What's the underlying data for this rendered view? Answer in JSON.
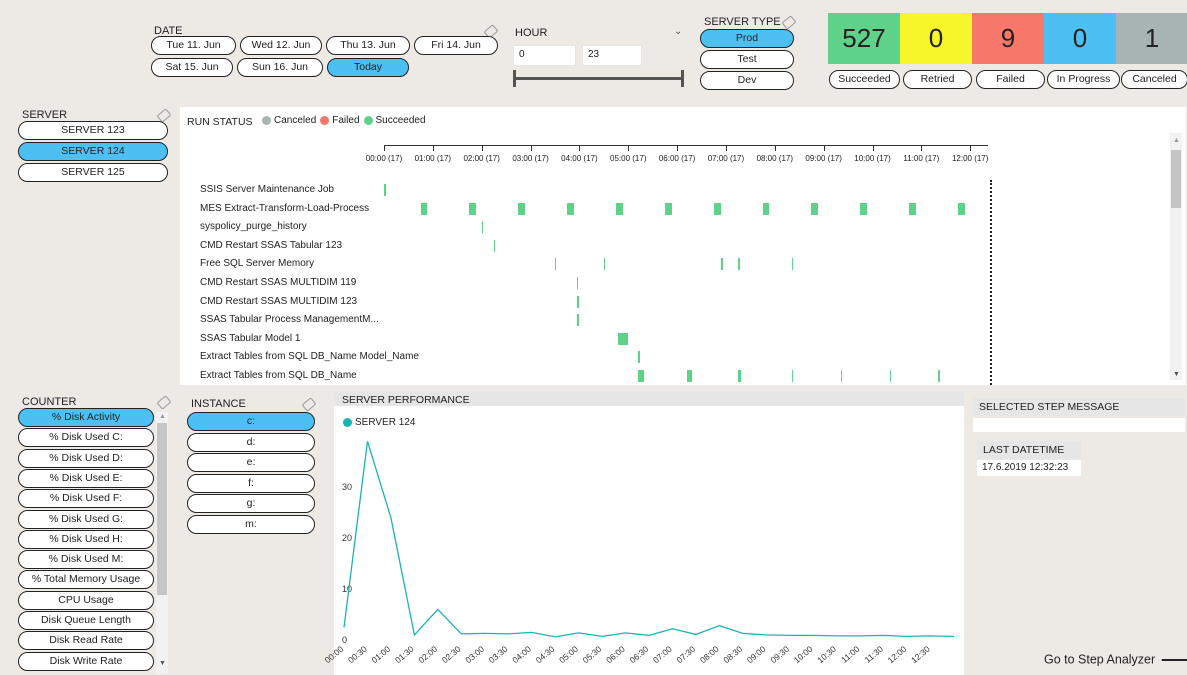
{
  "date": {
    "label": "DATE",
    "buttons": [
      "Tue 11. Jun",
      "Wed 12. Jun",
      "Thu 13. Jun",
      "Fri 14. Jun",
      "Sat 15. Jun",
      "Sun 16. Jun",
      "Today"
    ]
  },
  "hour": {
    "label": "HOUR",
    "min_value": "0",
    "max_value": "23"
  },
  "server_type": {
    "label": "SERVER TYPE",
    "options": [
      "Prod",
      "Test",
      "Dev"
    ],
    "selected": "Prod"
  },
  "kpis": [
    {
      "value": "527",
      "label": "Succeeded",
      "color": "#5fd28a"
    },
    {
      "value": "0",
      "label": "Retried",
      "color": "#f6f62a"
    },
    {
      "value": "9",
      "label": "Failed",
      "color": "#f7786a"
    },
    {
      "value": "0",
      "label": "In Progress",
      "color": "#4cc0f2"
    },
    {
      "value": "1",
      "label": "Canceled",
      "color": "#a8b4b4"
    }
  ],
  "server": {
    "label": "SERVER",
    "items": [
      "SERVER 123",
      "SERVER 124",
      "SERVER 125"
    ],
    "selected": "SERVER 124"
  },
  "run_status": {
    "title": "RUN STATUS",
    "legend": [
      {
        "name": "Canceled",
        "color": "#a8b4b4"
      },
      {
        "name": "Failed",
        "color": "#f7786a"
      },
      {
        "name": "Succeeded",
        "color": "#5fd28a"
      }
    ],
    "time_ticks": [
      "00:00 (17)",
      "01:00 (17)",
      "02:00 (17)",
      "03:00 (17)",
      "04:00 (17)",
      "05:00 (17)",
      "06:00 (17)",
      "07:00 (17)",
      "08:00 (17)",
      "09:00 (17)",
      "10:00 (17)",
      "11:00 (17)",
      "12:00 (17)"
    ],
    "jobs": [
      {
        "name": "SSIS Server Maintenance Job",
        "runs": [
          [
            0.0,
            0.01
          ]
        ]
      },
      {
        "name": "MES Extract-Transform-Load-Process",
        "runs": [
          [
            0.75,
            0.14
          ],
          [
            1.75,
            0.14
          ],
          [
            2.75,
            0.14
          ],
          [
            3.75,
            0.14
          ],
          [
            4.75,
            0.14
          ],
          [
            5.75,
            0.14
          ],
          [
            6.75,
            0.14
          ],
          [
            7.75,
            0.14
          ],
          [
            8.75,
            0.14
          ],
          [
            9.75,
            0.14
          ],
          [
            10.75,
            0.14
          ],
          [
            11.75,
            0.14
          ]
        ]
      },
      {
        "name": "syspolicy_purge_history",
        "runs": [
          [
            2.0,
            0.02
          ]
        ]
      },
      {
        "name": "CMD Restart SSAS Tabular 123",
        "runs": [
          [
            2.25,
            0.02
          ]
        ]
      },
      {
        "name": "Free SQL Server Memory",
        "runs": [
          [
            3.5,
            0.03
          ],
          [
            4.5,
            0.03
          ],
          [
            6.9,
            0.03
          ],
          [
            7.25,
            0.03
          ],
          [
            8.35,
            0.01
          ]
        ]
      },
      {
        "name": "CMD Restart SSAS MULTIDIM 119",
        "runs": [
          [
            3.95,
            0.02
          ]
        ]
      },
      {
        "name": "CMD Restart SSAS MULTIDIM 123",
        "runs": [
          [
            3.95,
            0.04
          ]
        ]
      },
      {
        "name": "SSAS Tabular Process ManagementM...",
        "runs": [
          [
            3.95,
            0.04
          ]
        ]
      },
      {
        "name": "SSAS Tabular Model 1",
        "runs": [
          [
            4.8,
            0.2
          ]
        ]
      },
      {
        "name": "Extract Tables from SQL DB_Name Model_Name",
        "runs": [
          [
            5.2,
            0.02
          ]
        ]
      },
      {
        "name": "Extract Tables from SQL DB_Name",
        "runs": [
          [
            5.2,
            0.12
          ],
          [
            6.2,
            0.1
          ],
          [
            7.25,
            0.06
          ],
          [
            8.35,
            0.02
          ],
          [
            9.35,
            0.02
          ],
          [
            10.35,
            0.02
          ],
          [
            11.35,
            0.02
          ]
        ]
      }
    ],
    "now_marker_hour": 12.4
  },
  "counter": {
    "label": "COUNTER",
    "items": [
      "% Disk Activity",
      "% Disk Used C:",
      "% Disk Used D:",
      "% Disk Used E:",
      "% Disk Used F:",
      "% Disk Used G:",
      "% Disk Used H:",
      "% Disk Used M:",
      "% Total Memory Usage",
      "CPU Usage",
      "Disk Queue Length",
      "Disk Read Rate",
      "Disk Write Rate"
    ],
    "selected": "% Disk Activity"
  },
  "instance": {
    "label": "INSTANCE",
    "items": [
      "c:",
      "d:",
      "e:",
      "f:",
      "g:",
      "m:"
    ],
    "selected": "c:"
  },
  "chart_data": {
    "type": "line",
    "title": "SERVER PERFORMANCE",
    "series": [
      {
        "name": "SERVER 124",
        "color": "#19b5b0",
        "values": [
          2.5,
          39,
          24,
          1,
          6,
          1.2,
          1.3,
          1.2,
          1.5,
          0.6,
          1.4,
          0.7,
          1.4,
          0.9,
          2.2,
          1.1,
          2.8,
          1.3,
          1.0,
          0.9,
          0.9,
          0.8,
          0.8,
          0.9,
          0.7,
          0.8,
          0.7
        ]
      }
    ],
    "x": [
      "00:00",
      "00:30",
      "01:00",
      "01:30",
      "02:00",
      "02:30",
      "03:00",
      "03:30",
      "04:00",
      "04:30",
      "05:00",
      "05:30",
      "06:00",
      "06:30",
      "07:00",
      "07:30",
      "08:00",
      "08:30",
      "09:00",
      "09:30",
      "10:00",
      "10:30",
      "11:00",
      "11:30",
      "12:00",
      "12:30",
      ""
    ],
    "yticks": [
      "0",
      "10",
      "20",
      "30"
    ],
    "ylim": [
      0,
      42
    ]
  },
  "step_message": {
    "label": "SELECTED STEP MESSAGE",
    "last_datetime_label": "LAST DATETIME",
    "last_datetime": "17.6.2019 12:32:23"
  },
  "nav": {
    "go_label": "Go to Step Analyzer"
  }
}
